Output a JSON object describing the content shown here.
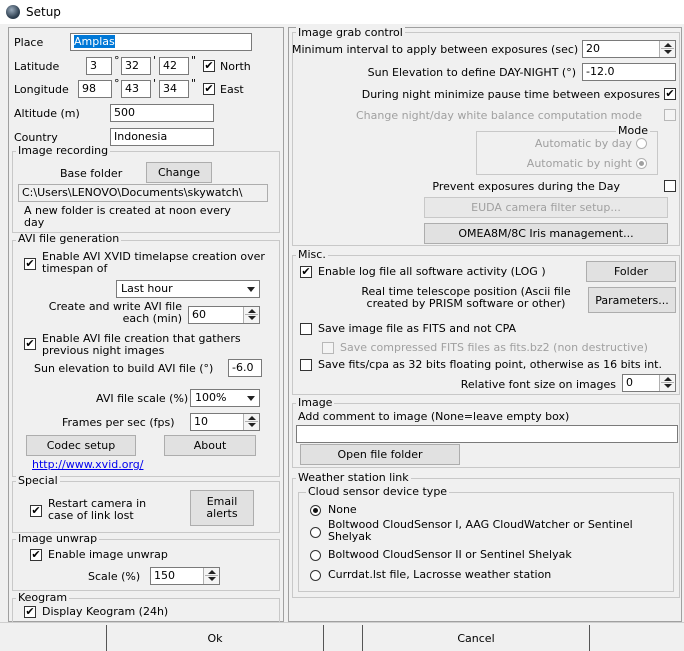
{
  "window": {
    "title": "Setup"
  },
  "left": {
    "place_label": "Place",
    "place_value": "Amplas",
    "latitude_label": "Latitude",
    "lat_deg": "3",
    "lat_min": "32",
    "lat_sec": "42",
    "deg_mark": "°",
    "min_mark": "'",
    "sec_mark": "\"",
    "north_label": "North",
    "longitude_label": "Longitude",
    "lon_deg": "98",
    "lon_min": "43",
    "lon_sec": "34",
    "east_label": "East",
    "altitude_label": "Altitude (m)",
    "altitude_value": "500",
    "country_label": "Country",
    "country_value": "Indonesia",
    "image_recording": {
      "title": "Image recording",
      "base_folder_label": "Base folder",
      "change_button": "Change",
      "path": "C:\\Users\\LENOVO\\Documents\\skywatch\\",
      "note": "A new folder is created at noon every day"
    },
    "avi": {
      "title": "AVI file generation",
      "xvid_label": "Enable AVI XVID timelapse creation over timespan of",
      "timespan_value": "Last hour",
      "create_label": "Create and write AVI file each (min)",
      "create_value": "60",
      "night_label": "Enable AVI file creation that gathers previous night images",
      "sun_label": "Sun elevation to build AVI file (°)",
      "sun_value": "-6.0",
      "scale_label": "AVI file scale (%)",
      "scale_value": "100%",
      "fps_label": "Frames per sec  (fps)",
      "fps_value": "10",
      "codec_button": "Codec setup",
      "about_button": "About",
      "link": "http://www.xvid.org/"
    },
    "special": {
      "title": "Special",
      "restart_label": "Restart camera in case of link lost",
      "email_button": "Email alerts"
    },
    "unwrap": {
      "title": "Image unwrap",
      "enable_label": "Enable image unwrap",
      "scale_label": "Scale (%)",
      "scale_value": "150"
    },
    "keogram": {
      "title": "Keogram",
      "display_label": "Display Keogram (24h)"
    }
  },
  "right": {
    "grab": {
      "title": "Image grab control",
      "min_interval_label": "Minimum interval to apply between exposures (sec)",
      "min_interval_value": "20",
      "sun_label": "Sun Elevation to define DAY-NIGHT  (°)",
      "sun_value": "-12.0",
      "night_min_label": "During night minimize pause time between exposures",
      "wb_label": "Change night/day white balance computation mode",
      "mode_title": "Mode",
      "auto_day_label": "Automatic by day",
      "auto_night_label": "Automatic by night",
      "prevent_label": "Prevent exposures during the Day",
      "euda_button": "EUDA camera filter setup...",
      "omea_button": "OMEA8M/8C Iris management..."
    },
    "misc": {
      "title": "Misc.",
      "log_label": "Enable log file all software activity (LOG )",
      "folder_button": "Folder",
      "telescope_label": "Real time telescope position (Ascii file created by PRISM software or other)",
      "parameters_button": "Parameters...",
      "fits_label": "Save image file as FITS and not CPA",
      "compressed_label": "Save compressed FITS files as fits.bz2 (non destructive)",
      "float_label": "Save fits/cpa as 32 bits floating point, otherwise as 16 bits int.",
      "font_label": "Relative font size on images",
      "font_value": "0"
    },
    "image": {
      "title": "Image",
      "comment_label": "Add comment to image (None=leave empty box)",
      "comment_value": "",
      "open_button": "Open file folder"
    },
    "weather": {
      "title": "Weather station link",
      "cloud_title": "Cloud sensor device type",
      "opt_none": "None",
      "opt_boltwood1": "Boltwood CloudSensor I, AAG CloudWatcher or Sentinel Shelyak",
      "opt_boltwood2": "Boltwood CloudSensor II or Sentinel Shelyak",
      "opt_currdat": "Currdat.lst file, Lacrosse weather station"
    }
  },
  "footer": {
    "ok": "Ok",
    "cancel": "Cancel"
  },
  "checks": {
    "mark": "✔"
  }
}
